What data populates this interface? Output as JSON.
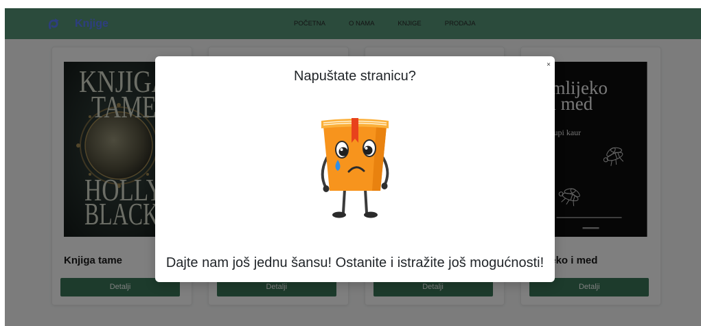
{
  "app": {
    "brand": "Knjige",
    "logo_icon": "book-logo-icon",
    "nav": {
      "home": "POČETNA",
      "about": "O NAMA",
      "books": "KNJIGE",
      "sale": "PRODAJA"
    }
  },
  "books": [
    {
      "title": "Knjiga tame",
      "cover": {
        "title_lines": [
          "KNJIGA",
          "TAME"
        ],
        "author_lines": [
          "HOLLY",
          "BLACK"
        ]
      },
      "button": "Detalji"
    },
    {
      "button": "Detalji"
    },
    {
      "button": "Detalji"
    },
    {
      "title": "Mlijeko i med",
      "cover": {
        "title_lines": [
          "mlijeko",
          "i med"
        ],
        "author": "rupi kaur"
      },
      "button": "Detalji"
    }
  ],
  "modal": {
    "visible": true,
    "close_label": "×",
    "title": "Napuštate stranicu?",
    "illustration_icon": "sad-book-icon",
    "message": "Dajte nam još jednu šansu! Ostanite i istražite još mogućnosti!"
  },
  "colors": {
    "navbar": "#579679",
    "brand": "#5b7cff",
    "button": "#3b7758",
    "book_orange": "#f7941d",
    "ribbon_red": "#e8421c",
    "tear_blue": "#2f8fe8"
  }
}
